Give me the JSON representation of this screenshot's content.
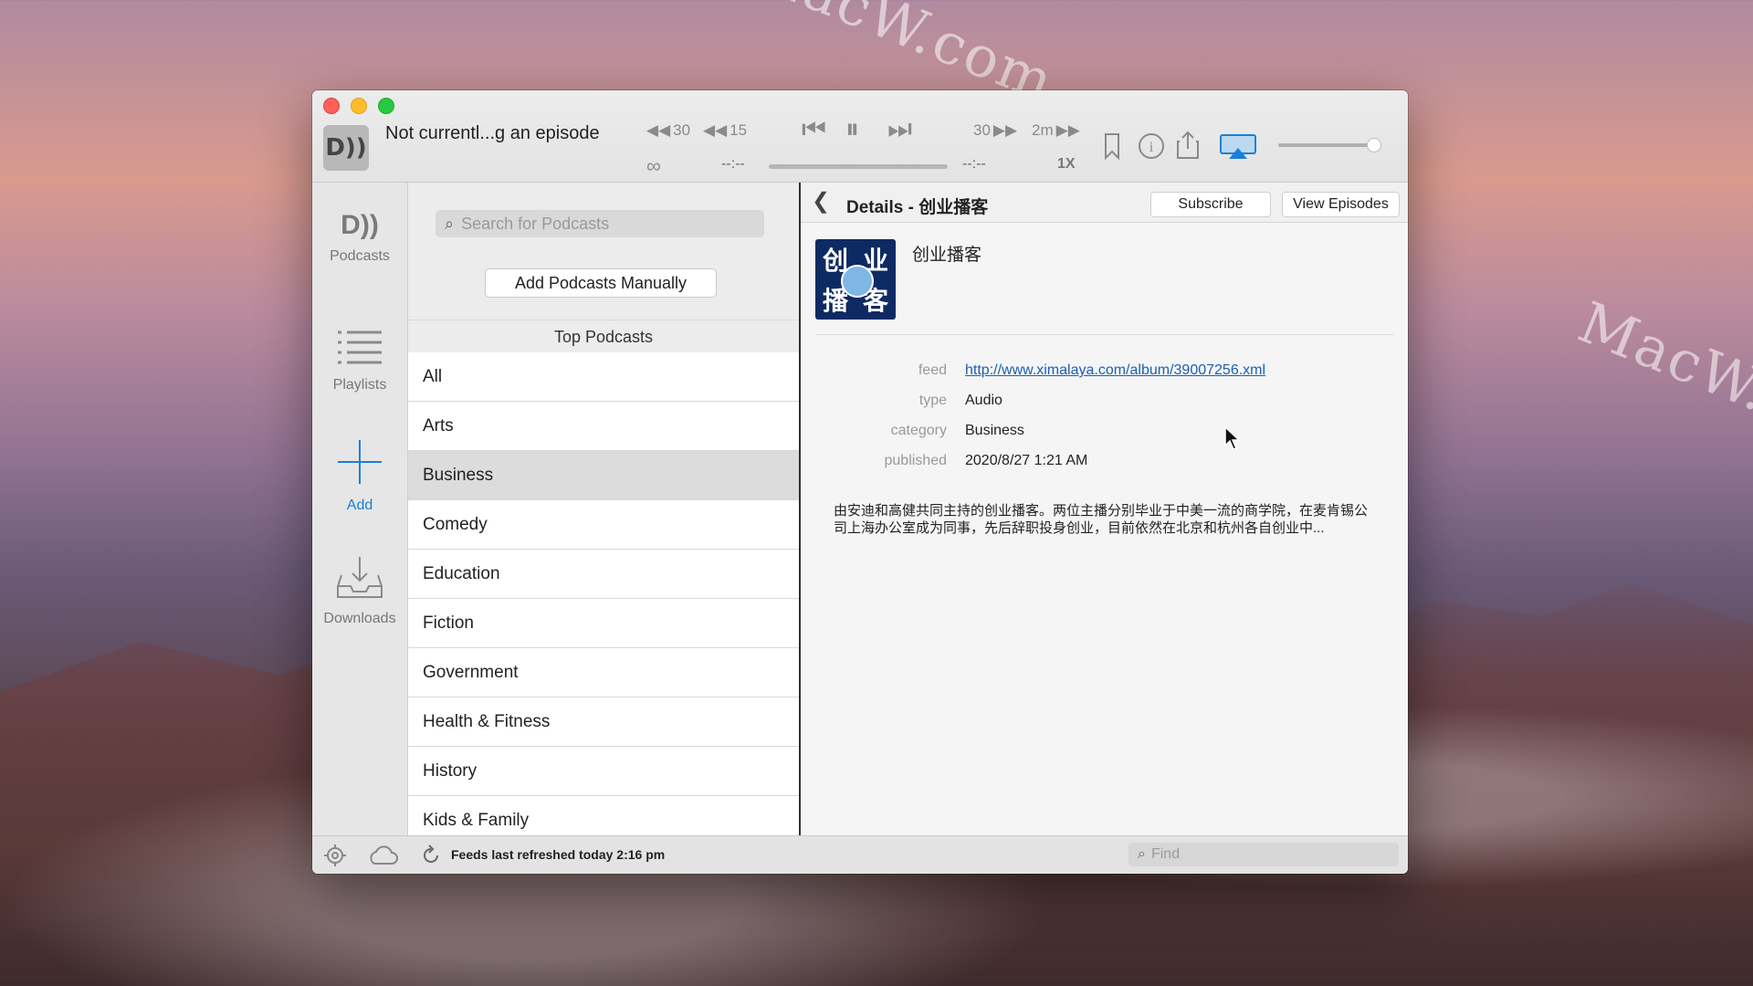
{
  "player": {
    "now_playing": "Not currentl...g an episode",
    "skip_back_30": "30",
    "skip_back_15": "15",
    "skip_fwd_30": "30",
    "skip_fwd_2m": "2m",
    "elapsed": "--:--",
    "remaining": "--:--",
    "speed": "1X"
  },
  "sidebar": {
    "items": [
      {
        "label": "Podcasts",
        "icon": "podcasts-icon"
      },
      {
        "label": "Playlists",
        "icon": "list-icon"
      },
      {
        "label": "Add",
        "icon": "plus-icon"
      },
      {
        "label": "Downloads",
        "icon": "download-tray-icon"
      }
    ]
  },
  "middle": {
    "search_placeholder": "Search for Podcasts",
    "add_manual_label": "Add Podcasts Manually",
    "list_title": "Top Podcasts",
    "categories": [
      "All",
      "Arts",
      "Business",
      "Comedy",
      "Education",
      "Fiction",
      "Government",
      "Health & Fitness",
      "History",
      "Kids & Family"
    ],
    "selected": "Business"
  },
  "detail": {
    "title": "Details - 创业播客",
    "subscribe_label": "Subscribe",
    "view_episodes_label": "View Episodes",
    "podcast_name": "创业播客",
    "artwork_chars": [
      "创",
      "业",
      "播",
      "客"
    ],
    "meta": [
      {
        "label": "feed",
        "value": "http://www.ximalaya.com/album/39007256.xml"
      },
      {
        "label": "type",
        "value": "Audio"
      },
      {
        "label": "category",
        "value": "Business"
      },
      {
        "label": "published",
        "value": "2020/8/27 1:21 AM"
      }
    ],
    "description": "由安迪和高健共同主持的创业播客。两位主播分别毕业于中美一流的商学院，在麦肯锡公司上海办公室成为同事，先后辞职投身创业，目前依然在北京和杭州各自创业中..."
  },
  "bottom": {
    "status": "Feeds last refreshed today 2:16 pm",
    "find_placeholder": "Find"
  },
  "watermark": "MacW.com",
  "colors": {
    "accent": "#1a7fd6",
    "selected_row": "#dcdcdc"
  }
}
